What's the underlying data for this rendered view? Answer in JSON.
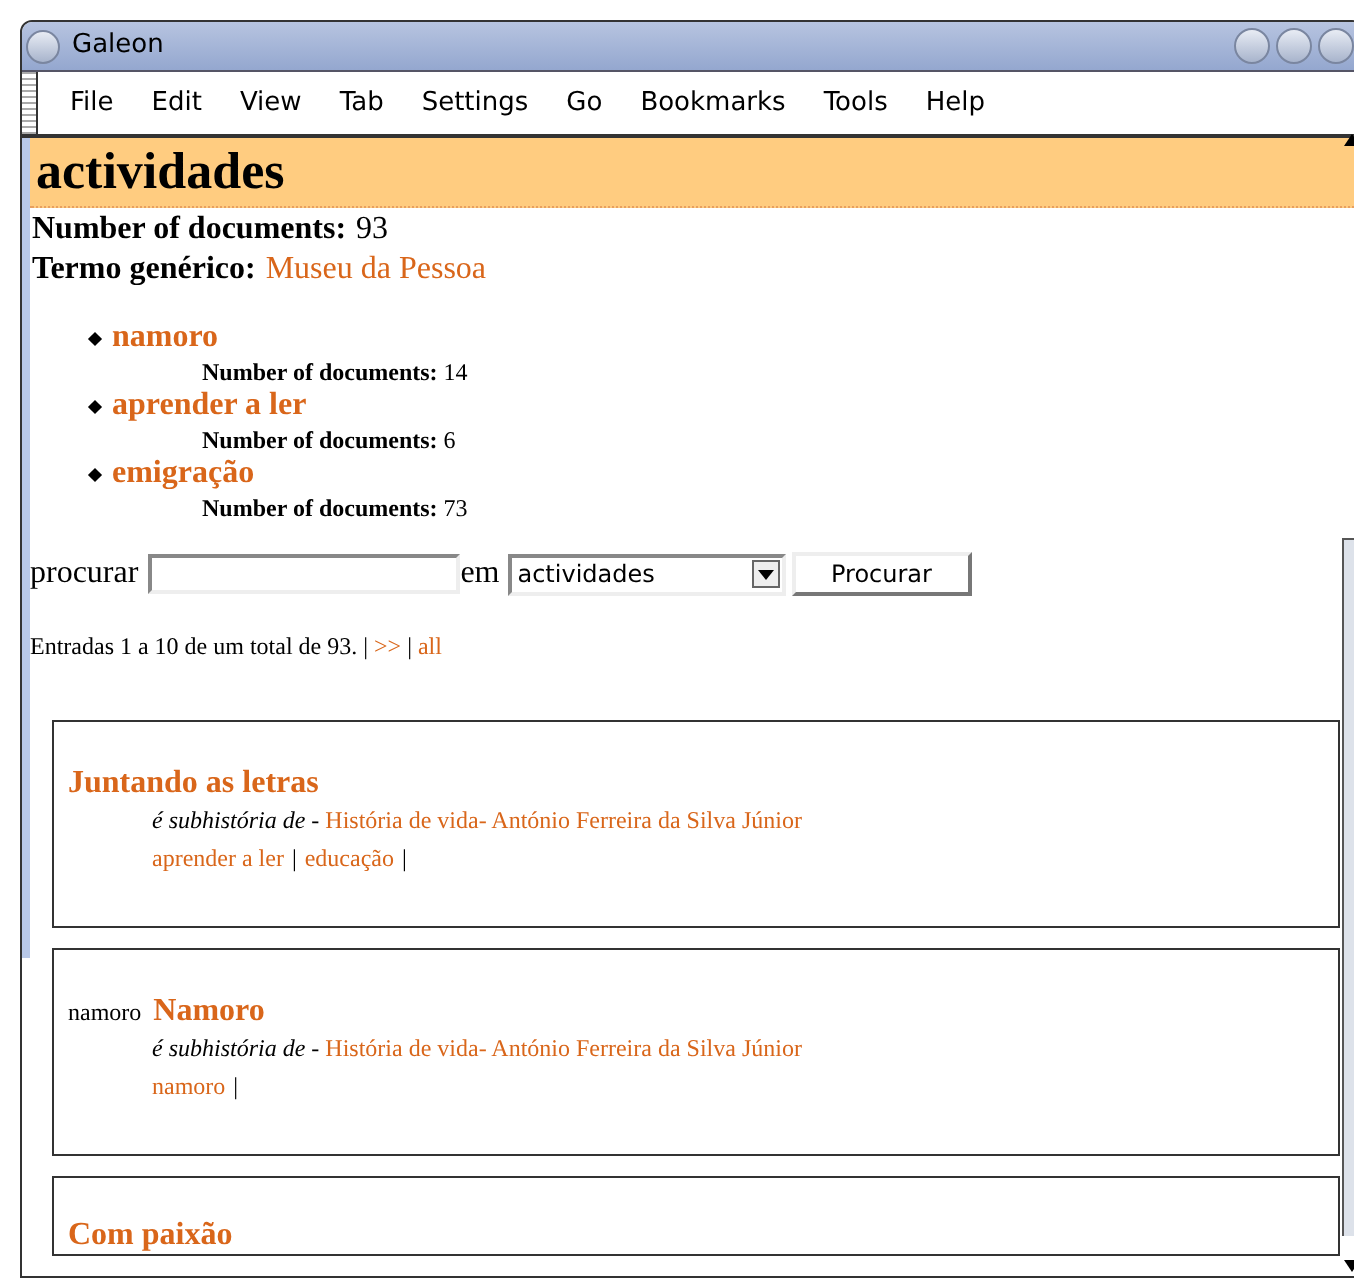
{
  "window": {
    "title": "Galeon"
  },
  "menu": [
    "File",
    "Edit",
    "View",
    "Tab",
    "Settings",
    "Go",
    "Bookmarks",
    "Tools",
    "Help"
  ],
  "heading": "actividades",
  "facts": [
    {
      "label": "Number of documents:",
      "value": "93",
      "kind": "text"
    },
    {
      "label": "Termo genérico:",
      "value": "Museu da Pessoa",
      "kind": "link"
    }
  ],
  "subterms": [
    {
      "name": "namoro",
      "count_label": "Number of documents:",
      "count": "14"
    },
    {
      "name": "aprender a ler",
      "count_label": "Number of documents:",
      "count": "6"
    },
    {
      "name": "emigração",
      "count_label": "Number of documents:",
      "count": "73"
    }
  ],
  "search": {
    "label": "procurar",
    "in_label": "em",
    "scope": "actividades",
    "button": "Procurar"
  },
  "pagination": [
    {
      "kind": "text",
      "text": "Entradas 1 a 10 de um total de 93."
    },
    {
      "kind": "sep",
      "text": "|"
    },
    {
      "kind": "link",
      "text": ">>"
    },
    {
      "kind": "sep",
      "text": "|"
    },
    {
      "kind": "link",
      "text": "all"
    }
  ],
  "results": [
    {
      "title": "Juntando as letras",
      "relation": "é subhistória de",
      "dash": "-",
      "parent": "História de vida- António Ferreira da Silva Júnior",
      "tags": [
        "aprender a ler",
        "educação"
      ],
      "tag_sep": "|"
    },
    {
      "prefix": "namoro",
      "title": "Namoro",
      "relation": "é subhistória de",
      "dash": "-",
      "parent": "História de vida- António Ferreira da Silva Júnior",
      "tags": [
        "namoro"
      ],
      "tag_sep": "|"
    },
    {
      "title": "Com paixão"
    }
  ]
}
